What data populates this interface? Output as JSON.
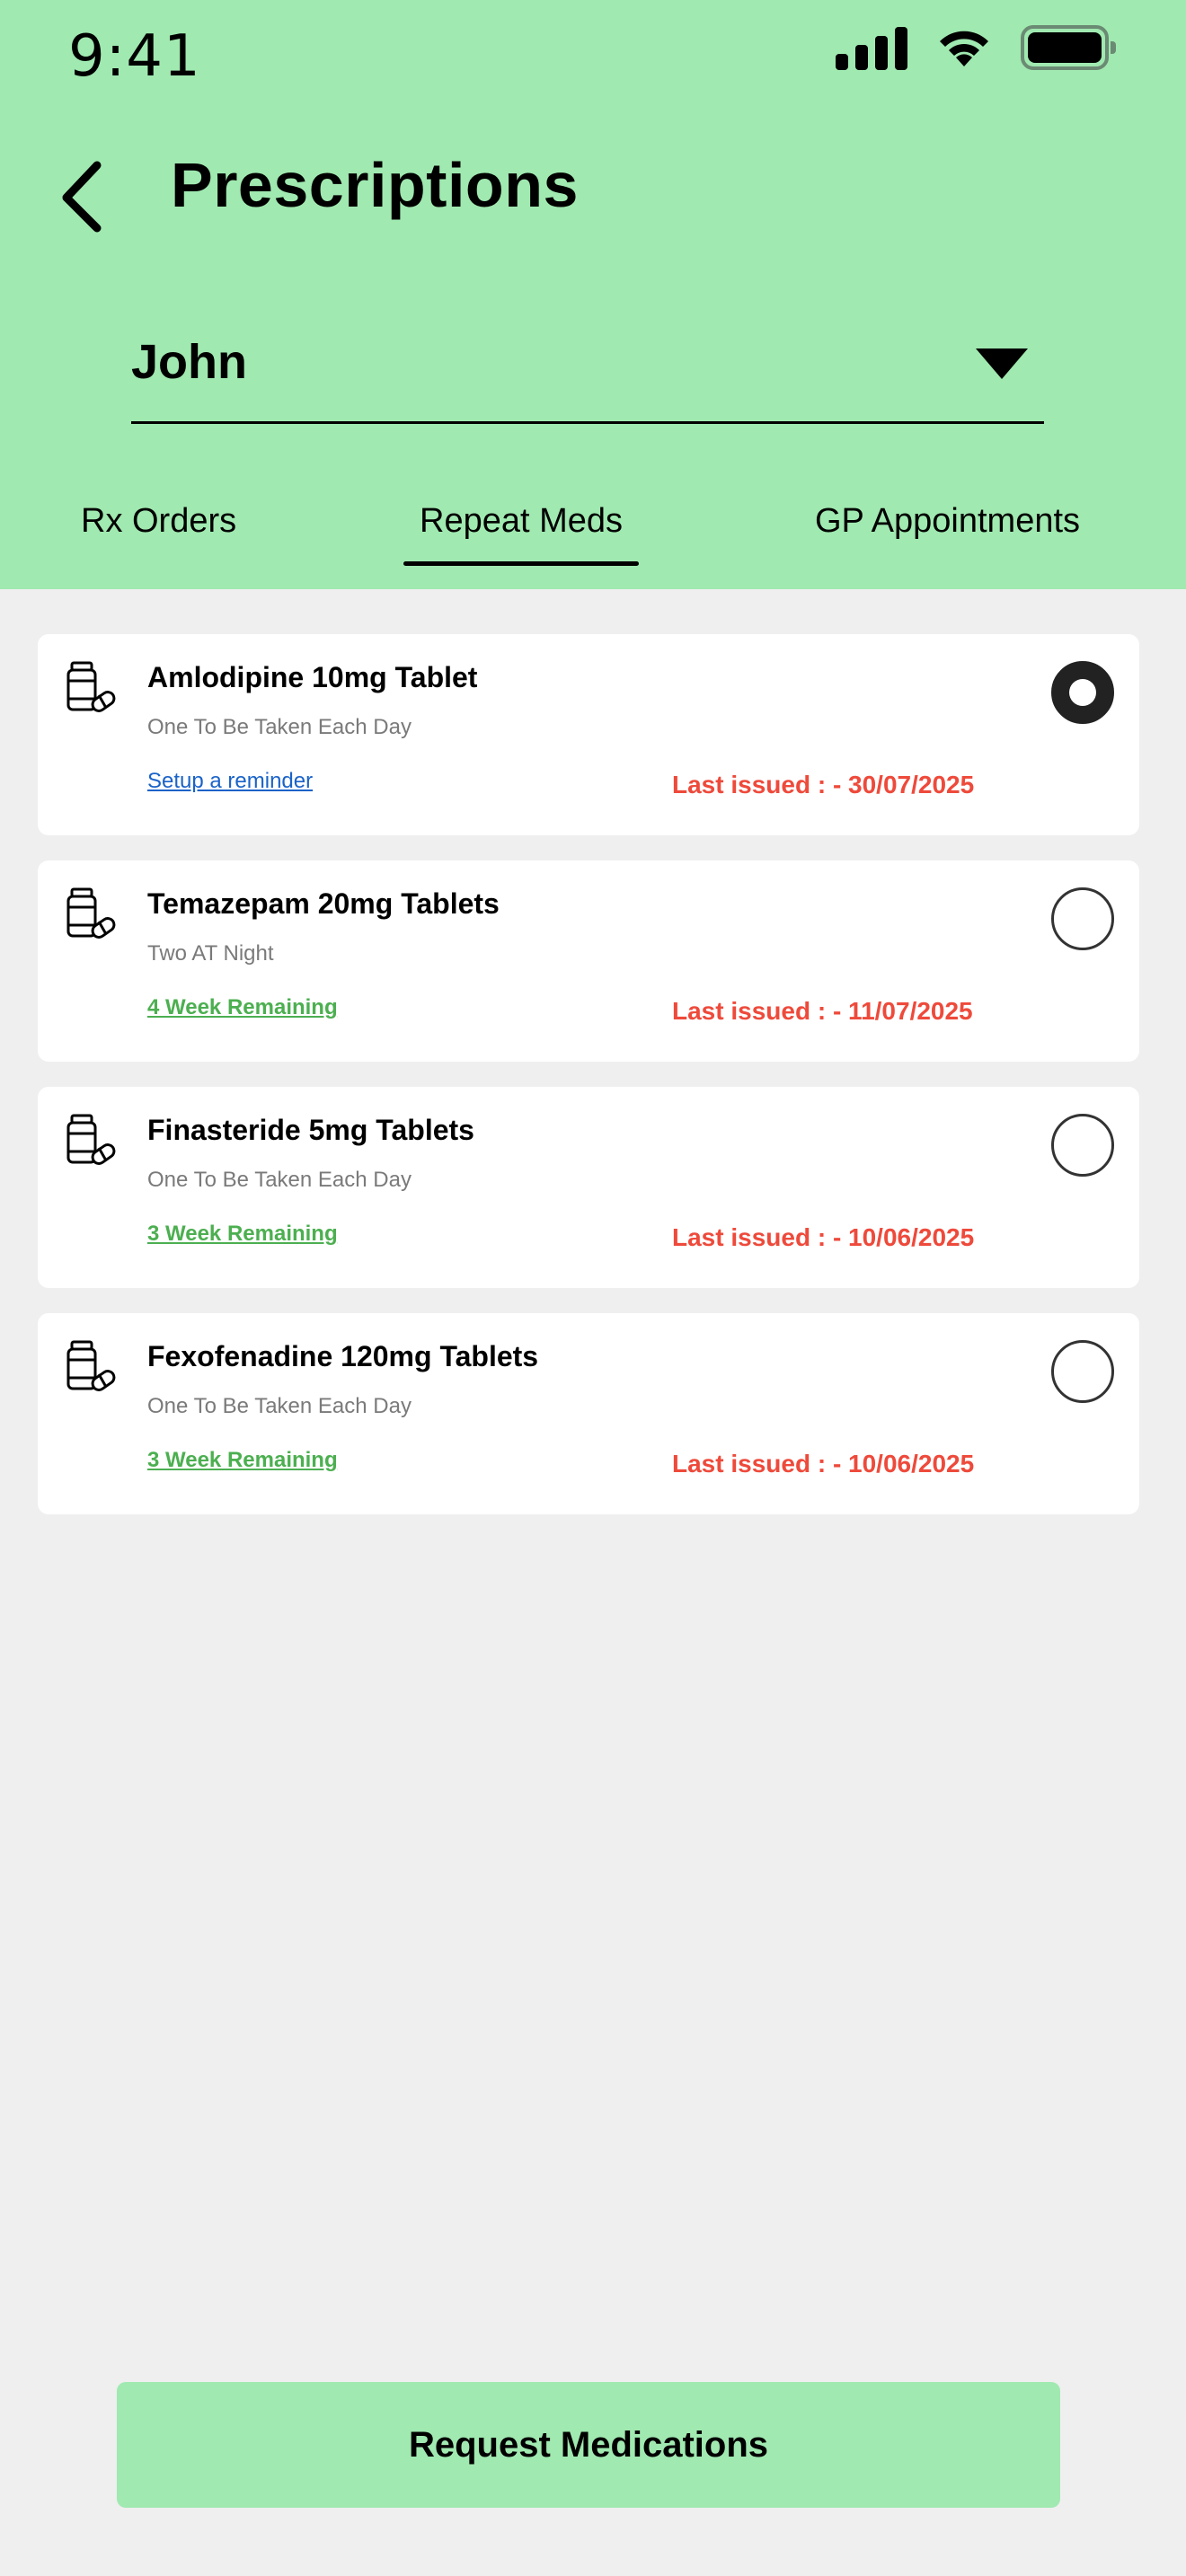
{
  "status_bar": {
    "time": "9:41"
  },
  "header": {
    "title": "Prescriptions"
  },
  "user_select": {
    "selected": "John"
  },
  "tabs": [
    {
      "label": "Rx Orders",
      "active": false
    },
    {
      "label": "Repeat Meds",
      "active": true
    },
    {
      "label": "GP Appointments",
      "active": false
    }
  ],
  "medications": [
    {
      "name": "Amlodipine 10mg Tablet",
      "dose": "One To Be Taken Each Day",
      "link": "Setup a reminder",
      "issued": "Last issued : - 30/07/2025",
      "selected": true
    },
    {
      "name": "Temazepam 20mg Tablets",
      "dose": "Two AT Night",
      "link": "4 Week Remaining",
      "issued": "Last issued : - 11/07/2025",
      "selected": false
    },
    {
      "name": "Finasteride 5mg Tablets",
      "dose": "One To Be Taken Each Day",
      "link": "3 Week Remaining",
      "issued": "Last issued : - 10/06/2025",
      "selected": false
    },
    {
      "name": "Fexofenadine 120mg Tablets",
      "dose": "One To Be Taken Each Day",
      "link": "3 Week Remaining",
      "issued": "Last issued : - 10/06/2025",
      "selected": false
    }
  ],
  "footer": {
    "request_label": "Request Medications"
  },
  "colors": {
    "header_bg": "#a0e9b0",
    "issued_red": "#ee4a3b",
    "remaining_green": "#4caf50",
    "reminder_blue": "#1a63c8"
  }
}
